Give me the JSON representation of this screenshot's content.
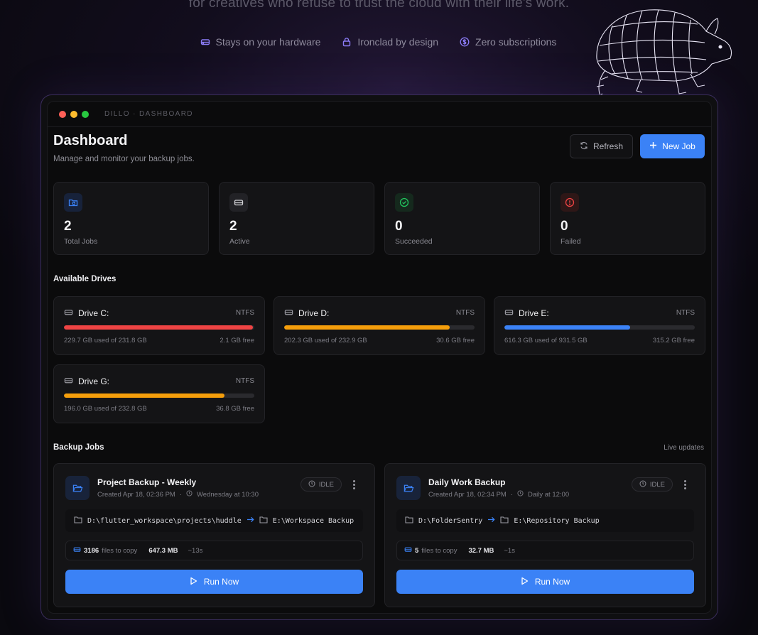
{
  "hero": {
    "tagline": "for creatives who refuse to trust the cloud with their life's work.",
    "features": [
      {
        "icon": "hard-drive-icon",
        "label": "Stays on your hardware"
      },
      {
        "icon": "lock-icon",
        "label": "Ironclad by design"
      },
      {
        "icon": "dollar-icon",
        "label": "Zero subscriptions"
      }
    ]
  },
  "window": {
    "title": "DILLO · DASHBOARD",
    "dots": [
      "#ff5f57",
      "#febc2e",
      "#28c840"
    ]
  },
  "dashboard": {
    "title": "Dashboard",
    "subtitle": "Manage and monitor your backup jobs.",
    "refresh_label": "Refresh",
    "new_job_label": "New Job"
  },
  "stats": [
    {
      "icon": "folder-sync-icon",
      "value": "2",
      "label": "Total Jobs",
      "color": "#3b82f6"
    },
    {
      "icon": "hard-drive-icon",
      "value": "2",
      "label": "Active",
      "color": "#d4d4d8"
    },
    {
      "icon": "check-circle-icon",
      "value": "0",
      "label": "Succeeded",
      "color": "#22c55e"
    },
    {
      "icon": "alert-circle-icon",
      "value": "0",
      "label": "Failed",
      "color": "#ef4444"
    }
  ],
  "drives_heading": "Available Drives",
  "drives": [
    {
      "name": "Drive C:",
      "fs": "NTFS",
      "used": "229.7 GB used of 231.8 GB",
      "free": "2.1 GB free",
      "fraction": 0.991,
      "color": "#ef4444"
    },
    {
      "name": "Drive D:",
      "fs": "NTFS",
      "used": "202.3 GB used of 232.9 GB",
      "free": "30.6 GB free",
      "fraction": 0.869,
      "color": "#f59e0b"
    },
    {
      "name": "Drive E:",
      "fs": "NTFS",
      "used": "616.3 GB used of 931.5 GB",
      "free": "315.2 GB free",
      "fraction": 0.662,
      "color": "#3b82f6"
    },
    {
      "name": "Drive G:",
      "fs": "NTFS",
      "used": "196.0 GB used of 232.8 GB",
      "free": "36.8 GB free",
      "fraction": 0.842,
      "color": "#f59e0b"
    }
  ],
  "jobs_heading": "Backup Jobs",
  "live_label": "Live updates",
  "jobs": [
    {
      "name": "Project Backup - Weekly",
      "created": "Created Apr 18, 02:36 PM",
      "schedule": "Wednesday at 10:30",
      "status": "IDLE",
      "source": "D:\\flutter_workspace\\projects\\huddle",
      "destination": "E:\\Workspace Backup",
      "files_count": "3186",
      "files_label": "files to copy",
      "size": "647.3 MB",
      "eta": "~13s",
      "run_label": "Run Now"
    },
    {
      "name": "Daily Work Backup",
      "created": "Created Apr 18, 02:34 PM",
      "schedule": "Daily at 12:00",
      "status": "IDLE",
      "source": "D:\\FolderSentry",
      "destination": "E:\\Repository Backup",
      "files_count": "5",
      "files_label": "files to copy",
      "size": "32.7 MB",
      "eta": "~1s",
      "run_label": "Run Now"
    }
  ]
}
